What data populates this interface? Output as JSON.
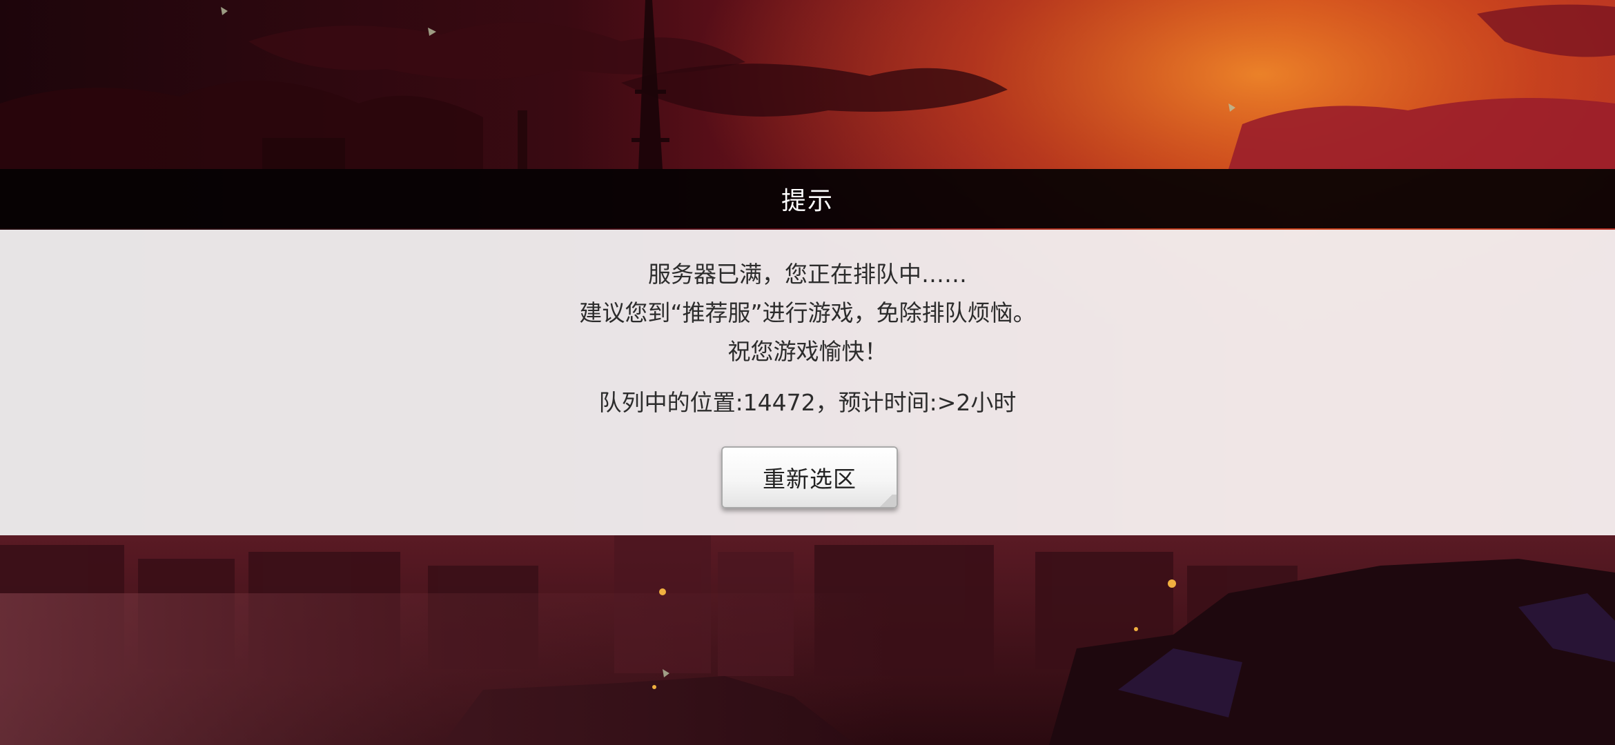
{
  "dialog": {
    "title": "提示",
    "message_lines": [
      "服务器已满，您正在排队中……",
      "建议您到“推荐服”进行游戏，免除排队烦恼。",
      "祝您游戏愉快！"
    ],
    "queue_status": "队列中的位置:14472，预计时间:>2小时",
    "reselect_button_label": "重新选区"
  },
  "colors": {
    "sky_dark": "#1c0409",
    "sky_red": "#8a1622",
    "sky_orange": "#d8541a",
    "header_bg": "#060203",
    "body_bg": "#f2f0f1",
    "text": "#2c2c2c"
  }
}
